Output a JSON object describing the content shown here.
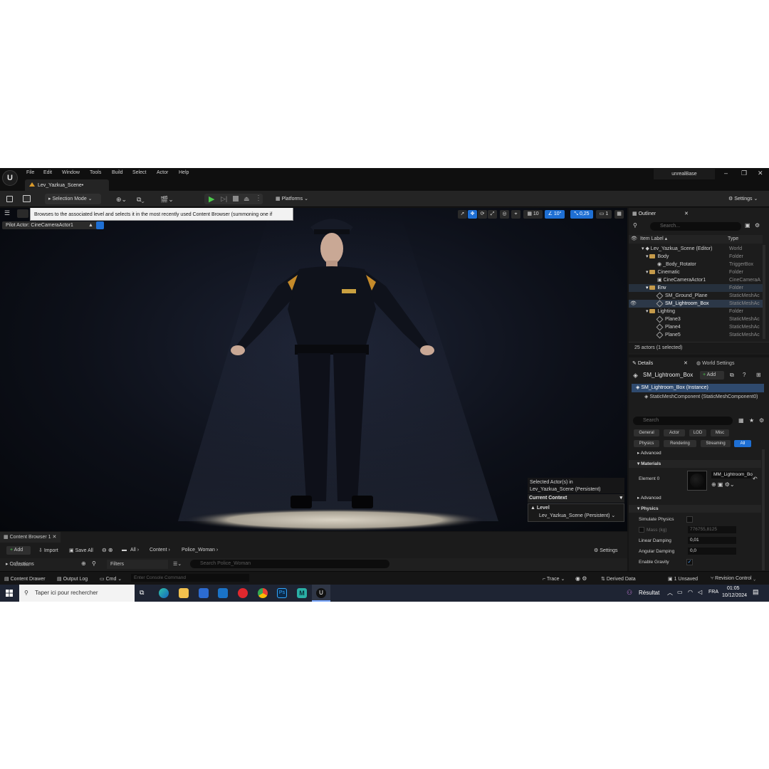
{
  "menu": {
    "items": [
      "File",
      "Edit",
      "Window",
      "Tools",
      "Build",
      "Select",
      "Actor",
      "Help"
    ],
    "project": "unrealBase"
  },
  "tab": {
    "label": "Lev_Yazkua_Scene•"
  },
  "toolbar": {
    "selection_mode": "Selection Mode",
    "platforms": "Platforms",
    "settings": "Settings"
  },
  "viewport": {
    "tooltip": "Browses to the associated level and selects it in the most recently used Content Browser (summoning one if necessary)",
    "pilot": "Pilot Actor: CineCameraActor1",
    "grid": "10",
    "angle": "10°",
    "scale": "0,25",
    "camera_speed": "1",
    "context": {
      "selected": "Selected Actor(s) in",
      "level_name": "Lev_Yazkua_Scene (Persistent)",
      "current_context": "Current Context",
      "level_label": "Level",
      "level_value": "Lev_Yazkua_Scene (Persistent)"
    }
  },
  "outliner": {
    "title": "Outliner",
    "search": "Search...",
    "col_label": "Item Label ▴",
    "col_type": "Type",
    "rows": [
      {
        "label": "Lev_Yazkua_Scene (Editor)",
        "type": "World"
      },
      {
        "label": "Body",
        "type": "Folder"
      },
      {
        "label": "_Body_Rotator",
        "type": "TriggerBox"
      },
      {
        "label": "Cinematic",
        "type": "Folder"
      },
      {
        "label": "CineCameraActor1",
        "type": "CineCameraA"
      },
      {
        "label": "Env",
        "type": "Folder"
      },
      {
        "label": "SM_Ground_Plane",
        "type": "StaticMeshAc"
      },
      {
        "label": "SM_Lightroom_Box",
        "type": "StaticMeshAc"
      },
      {
        "label": "Lighting",
        "type": "Folder"
      },
      {
        "label": "Plane3",
        "type": "StaticMeshAc"
      },
      {
        "label": "Plane4",
        "type": "StaticMeshAc"
      },
      {
        "label": "Plane5",
        "type": "StaticMeshAc"
      }
    ],
    "count": "25 actors (1 selected)"
  },
  "details": {
    "tab": "Details",
    "tab2": "World Settings",
    "actor": "SM_Lightroom_Box",
    "add": "Add",
    "instance": "SM_Lightroom_Box (Instance)",
    "component": "StaticMeshComponent (StaticMeshComponent0)",
    "search": "Search",
    "filters": [
      "General",
      "Actor",
      "LOD",
      "Misc",
      "Physics",
      "Rendering",
      "Streaming",
      "All"
    ],
    "advanced": "Advanced",
    "materials": "Materials",
    "element0": "Element 0",
    "material_name": "MM_Lightroom_Bo",
    "advanced2": "Advanced",
    "physics": "Physics",
    "props": {
      "simulate_physics": "Simulate Physics",
      "mass": "Mass (kg)",
      "mass_value": "776755,8125",
      "linear_damping": "Linear Damping",
      "linear_value": "0,01",
      "angular_damping": "Angular Damping",
      "angular_value": "0,0",
      "enable_gravity": "Enable Gravity"
    }
  },
  "content_browser": {
    "tab": "Content Browser 1",
    "add": "Add",
    "import": "Import",
    "save_all": "Save All",
    "crumbs": [
      "All",
      "Content",
      "Police_Woman"
    ],
    "settings": "Settings",
    "collections": "Collections",
    "favorites": "Favorites",
    "filters": "Filters",
    "search": "Search Police_Woman"
  },
  "statusbar": {
    "content_drawer": "Content Drawer",
    "output_log": "Output Log",
    "cmd": "Cmd",
    "console": "Enter Console Command",
    "trace": "Trace",
    "derived": "Derived Data",
    "unsaved": "1 Unsaved",
    "revision": "Revision Control"
  },
  "taskbar": {
    "search": "Taper ici pour rechercher",
    "result": "Résultat",
    "lang": "FRA",
    "time": "01:05",
    "date": "10/12/2024"
  },
  "colors": {
    "accent": "#1e6fd4",
    "folder": "#c59a4a",
    "bg": "#151515"
  }
}
